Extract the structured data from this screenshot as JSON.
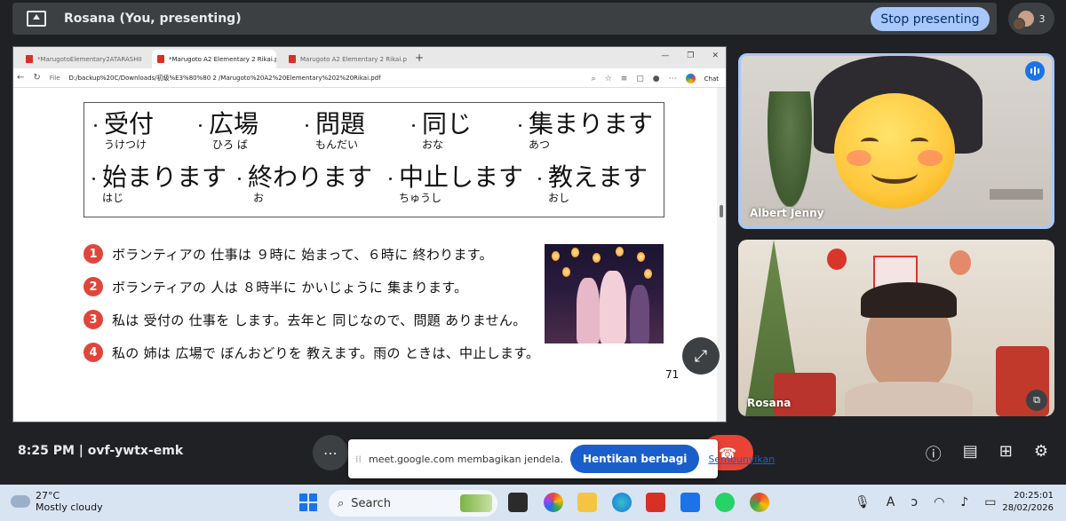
{
  "presenting_bar": {
    "title": "Rosana (You, presenting)",
    "stop_label": "Stop presenting",
    "participant_count": "3"
  },
  "browser": {
    "tabs": [
      {
        "label": "*MarugotoElementary2ATARASHII"
      },
      {
        "label": "*Marugoto A2 Elementary 2 Rikai.p"
      },
      {
        "label": "Marugoto A2 Elementary 2 Rikai.p"
      }
    ],
    "tab_close": "✕",
    "new_tab": "+",
    "file_label": "File",
    "url": "D:/backup%20C/Downloads/初級%E3%80%80 2 /Marugoto%20A2%20Elementary%202%20Rikai.pdf",
    "chat_label": "Chat"
  },
  "pdf": {
    "vocab": [
      {
        "kanji": "受付",
        "furigana": "うけつけ"
      },
      {
        "kanji": "広場",
        "furigana": "ひろ ば"
      },
      {
        "kanji": "問題",
        "furigana": "もんだい"
      },
      {
        "kanji": "同じ",
        "furigana": "おな"
      },
      {
        "kanji": "集まります",
        "furigana": "あつ"
      },
      {
        "kanji": "始まります",
        "furigana": "はじ"
      },
      {
        "kanji": "終わります",
        "furigana": "お"
      },
      {
        "kanji": "中止します",
        "furigana": "ちゅうし"
      },
      {
        "kanji": "教えます",
        "furigana": "おし"
      }
    ],
    "sentences": [
      {
        "num": "1",
        "text": "ボランティアの 仕事は ９時に 始まって、６時に 終わります。"
      },
      {
        "num": "2",
        "text": "ボランティアの 人は ８時半に かいじょうに 集まります。"
      },
      {
        "num": "3",
        "text": "私は 受付の 仕事を します。去年と 同じなので、問題 ありません。"
      },
      {
        "num": "4",
        "text": "私の 姉は 広場で ぼんおどりを 教えます。雨の ときは、中止します。"
      }
    ],
    "page_number": "71"
  },
  "tiles": {
    "albert": {
      "name": "Albert Jenny"
    },
    "rosana": {
      "name": "Rosana"
    }
  },
  "bottom": {
    "time_code": "8:25 PM  |  ovf-ywtx-emk",
    "more_label": "⋯"
  },
  "share_banner": {
    "message": "meet.google.com membagikan jendela.",
    "stop_label": "Hentikan berbagi",
    "hide_label": "Sembunyikan"
  },
  "taskbar": {
    "temperature": "27°C",
    "weather": "Mostly cloudy",
    "search_label": "Search",
    "time": "20:25:01",
    "date": "28/02/2026"
  }
}
